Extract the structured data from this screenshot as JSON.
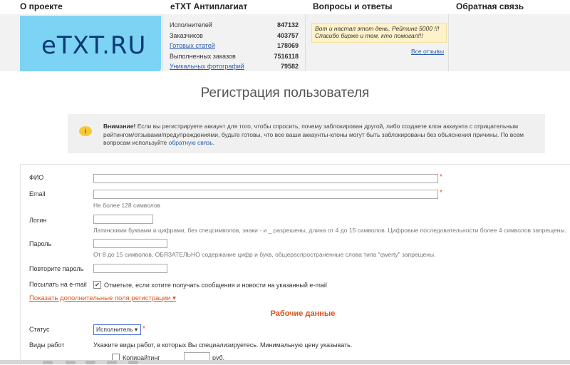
{
  "nav": {
    "items": [
      "О проекте",
      "eTXT Антиплагиат",
      "Вопросы и ответы",
      "Обратная связь"
    ]
  },
  "logo": {
    "text": "eTXT.RU"
  },
  "stats": [
    {
      "label": "Исполнителей",
      "value": "847132",
      "link": false
    },
    {
      "label": "Заказчиков",
      "value": "403757",
      "link": false
    },
    {
      "label": "Готовых статей",
      "value": "178069",
      "link": true
    },
    {
      "label": "Выполненных заказов",
      "value": "7516118",
      "link": false
    },
    {
      "label": "Уникальных фотографий",
      "value": "79582",
      "link": true
    }
  ],
  "quote": {
    "text": "Вот и настал этот день. Рейтинг 5000 !!! Спасибо бирже и тем, кто помогал!!!"
  },
  "all_reviews": "Все отзывы",
  "page_title": "Регистрация пользователя",
  "warning": {
    "bold": "Внимание!",
    "text": " Если вы регистрируете аккаунт для того, чтобы спросить, почему заблокирован другой, либо создаете клон аккаунта с отрицательным рейтингом/отзывами/предупреждениями, будьте готовы, что все ваши аккаунты-клоны могут быть заблокированы без объяснения причины. По всем вопросам используйте ",
    "link": "обратную связь",
    "end": "."
  },
  "form": {
    "fio_label": "ФИО",
    "email_label": "Email",
    "email_hint": "Не более 128 символов",
    "login_label": "Логин",
    "login_hint": "Латинскими буквами и цифрами, без спецсимволов, знаки - и _ разрешены, длина от 4 до 15 символов. Цифровые последовательности более 4 символов запрещены.",
    "password_label": "Пароль",
    "password_hint": "От 8 до 15 символов, ОБЯЗАТЕЛЬНО содержание цифр и букв, общераспространенные слова типа \"qwerty\" запрещены.",
    "repeat_label": "Повторите пароль",
    "send_email_label": "Посылать на e-mail",
    "send_email_checked": true,
    "send_email_text": "Отметьте, если хотите получать сообщения и новости на указанный e-mail",
    "more_fields_link": "Показать дополнительные поля регистрации ▾",
    "required_mark": "*"
  },
  "work": {
    "section_title": "Рабочие данные",
    "status_label": "Статус",
    "status_value": "Исполнитель ▾",
    "types_label": "Виды работ",
    "types_hint": "Укажите виды работ, в которых Вы специализируетесь. Минимальную цену указывать.",
    "copywriting_label": "Копирайтинг",
    "currency": "руб."
  },
  "colors": {
    "accent": "#d9541e",
    "logo_bg": "#7cd3f4",
    "link": "#2a5db0"
  }
}
